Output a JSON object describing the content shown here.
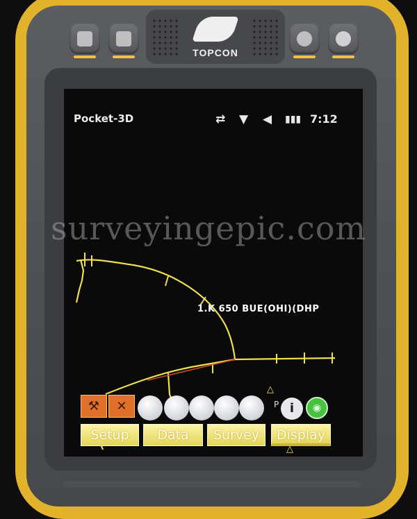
{
  "device": {
    "brand": "TOPCON"
  },
  "statusbar": {
    "app_title": "Pocket-3D",
    "time": "7:12",
    "icons": [
      "network-disconnected-icon",
      "antenna-no-signal-icon",
      "speaker-muted-icon",
      "battery-icon"
    ]
  },
  "watermark": "surveyingepic.com",
  "map": {
    "point_label": "1.K 650 BUE(OHI)(DHP"
  },
  "toolbar": {
    "tool_icons": [
      "survey-tripod-icon",
      "no-signal-tower-icon"
    ],
    "info_prefix": "P",
    "info_label": "i",
    "gps_label": "GPS"
  },
  "tabs": [
    {
      "label": "Setup"
    },
    {
      "label": "Data"
    },
    {
      "label": "Survey"
    },
    {
      "label": "Display"
    }
  ],
  "colors": {
    "casing": "#e2b32a",
    "linework": "#f0e050",
    "tab": "#f0e27a",
    "gps": "#46c23e",
    "tool": "#e0702a"
  }
}
